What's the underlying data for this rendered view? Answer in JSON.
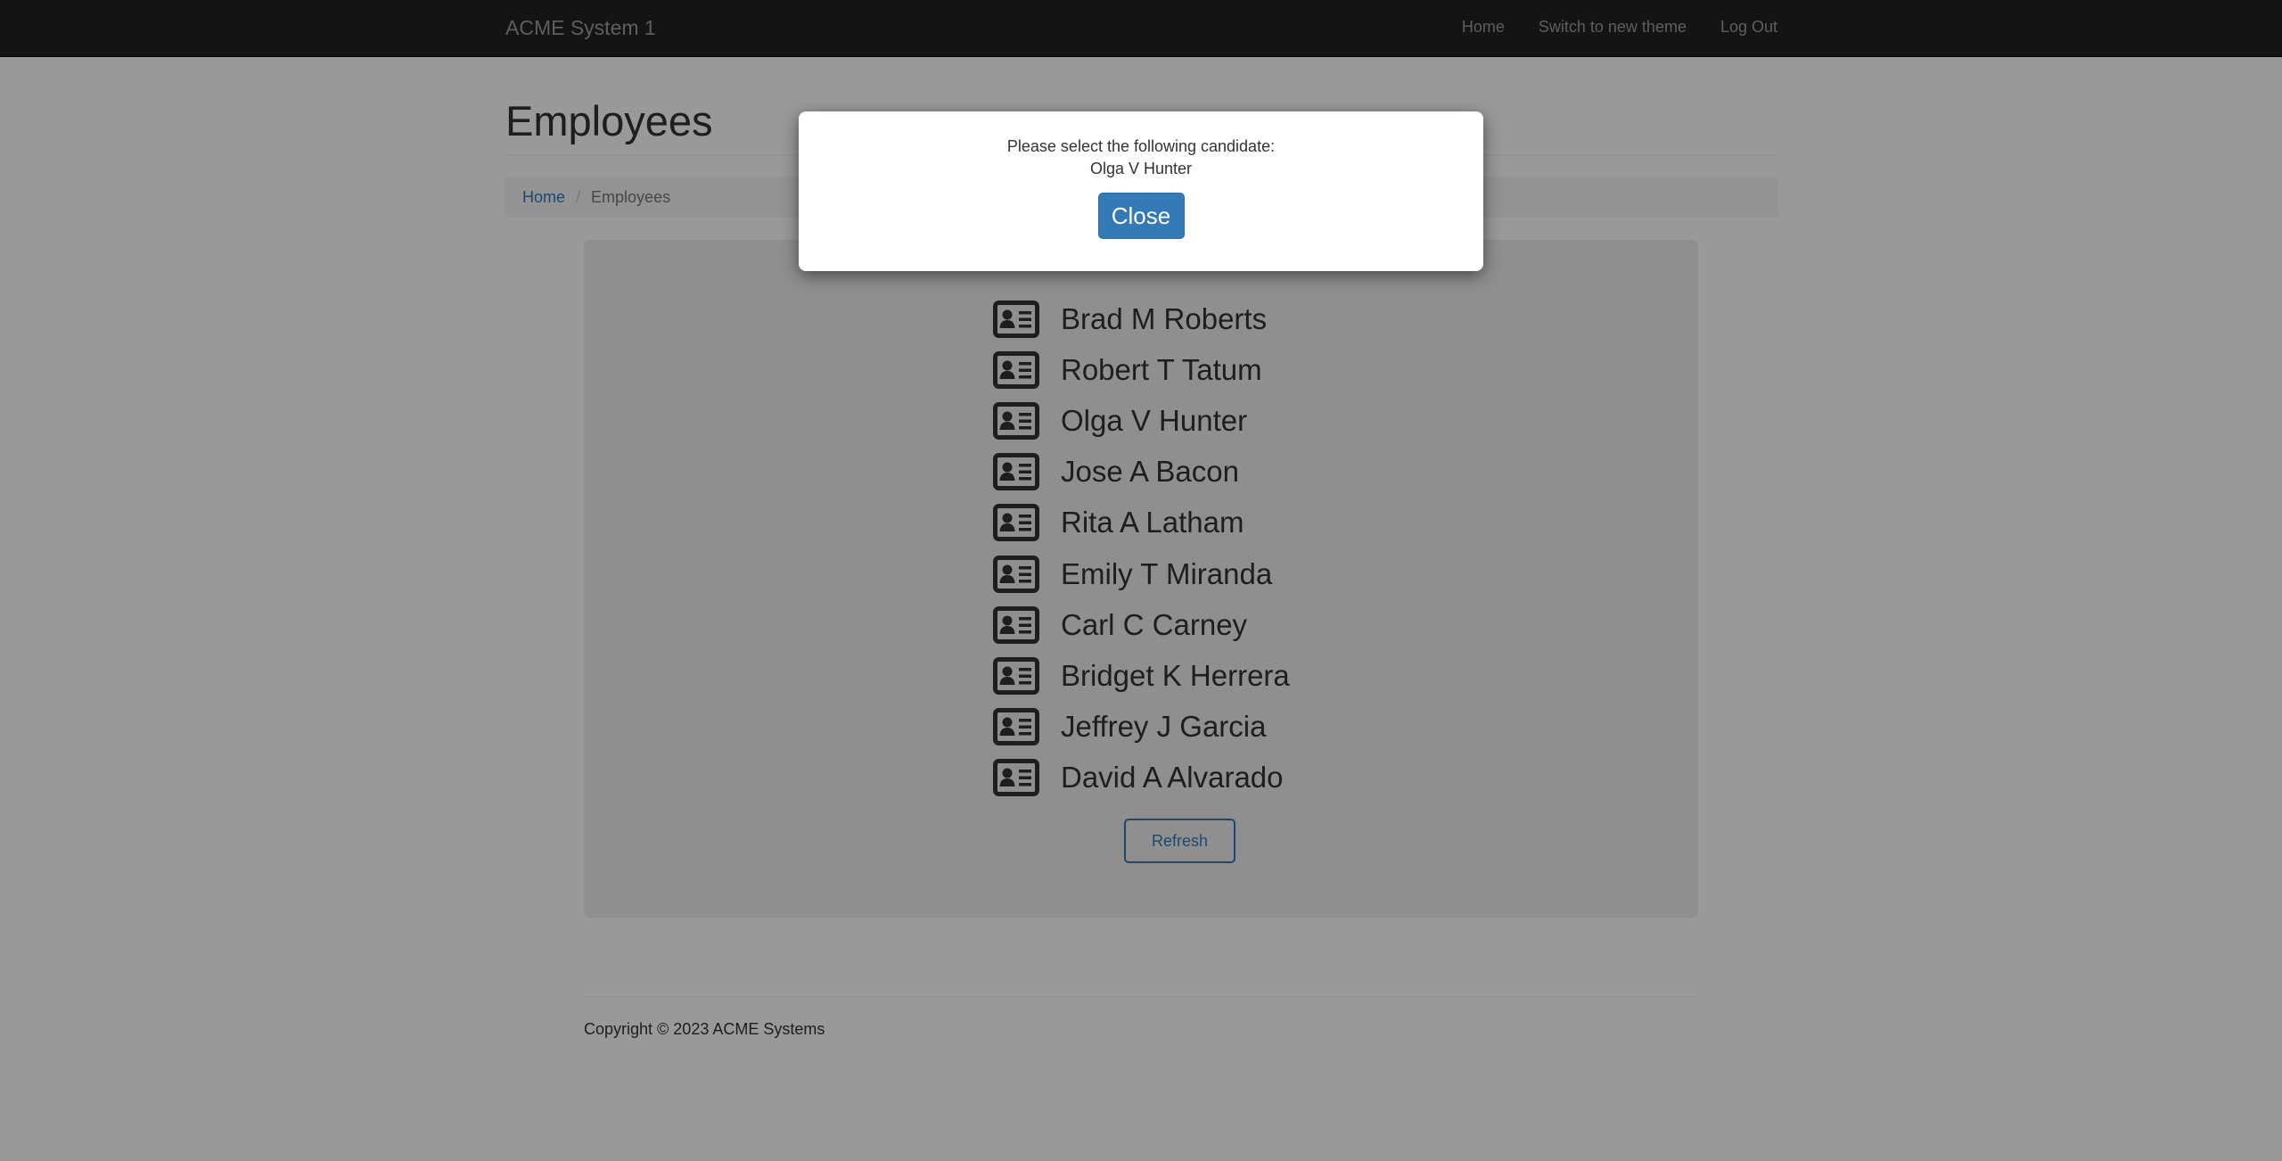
{
  "navbar": {
    "brand": "ACME System 1",
    "links": [
      "Home",
      "Switch to new theme",
      "Log Out"
    ]
  },
  "page": {
    "title": "Employees",
    "breadcrumb": {
      "home": "Home",
      "separator": "/",
      "current": "Employees"
    }
  },
  "employees": [
    "Brad M Roberts",
    "Robert T Tatum",
    "Olga V Hunter",
    "Jose A Bacon",
    "Rita A Latham",
    "Emily T Miranda",
    "Carl C Carney",
    "Bridget K Herrera",
    "Jeffrey J Garcia",
    "David A Alvarado"
  ],
  "employee_icon": "id-card-icon",
  "refresh_label": "Refresh",
  "footer": {
    "copyright": "Copyright © 2023 ACME Systems"
  },
  "modal": {
    "message": "Please select the following candidate:",
    "candidate": "Olga V Hunter",
    "close_label": "Close"
  },
  "colors": {
    "navbar_bg": "#222222",
    "link": "#337ab7",
    "primary_button": "#337ab7",
    "panel_bg": "#eeeeee"
  }
}
